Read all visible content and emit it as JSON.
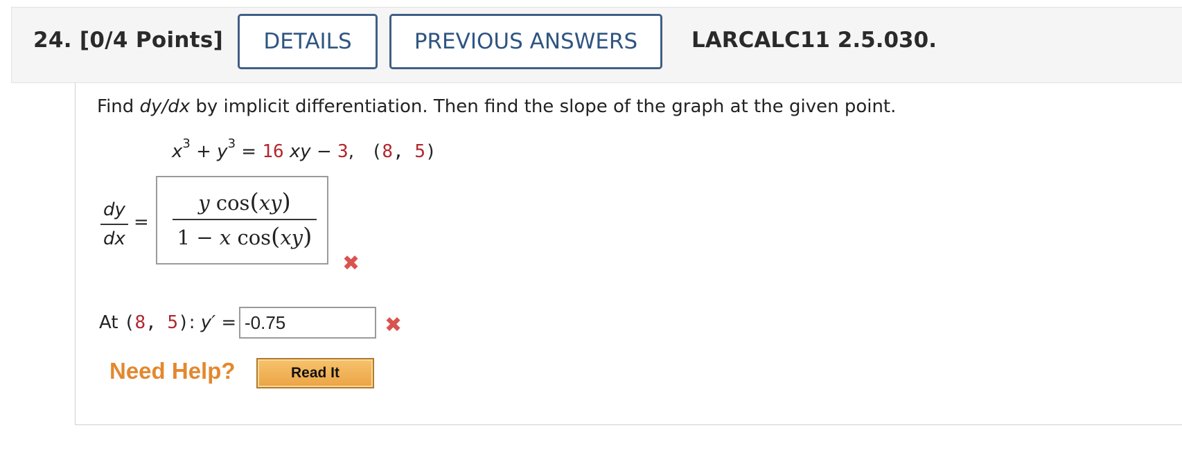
{
  "header": {
    "question_number": "24.",
    "points": "[0/4 Points]",
    "details_label": "DETAILS",
    "previous_answers_label": "PREVIOUS ANSWERS",
    "problem_code": "LARCALC11 2.5.030."
  },
  "question": {
    "prompt_find": "Find ",
    "prompt_dydx": "dy/dx",
    "prompt_rest": " by implicit differentiation. Then find the slope of the graph at the given point.",
    "eq_x": "x",
    "eq_exp1": "3",
    "eq_plus": " + ",
    "eq_y": "y",
    "eq_exp2": "3",
    "eq_equals": " = ",
    "eq_coef": "16",
    "eq_xy": " xy",
    "eq_minus": " − ",
    "eq_const": "3",
    "eq_comma": ",   ",
    "point": "(8, 5)"
  },
  "derivative": {
    "label_num": "dy",
    "label_den": "dx",
    "equals": "=",
    "answer_num_y": "y",
    "answer_num_cos": " cos",
    "answer_num_xy": "xy",
    "answer_den_one": "1",
    "answer_den_minus": " − ",
    "answer_den_x": "x",
    "answer_den_cos": " cos",
    "answer_den_xy": "xy",
    "status": "incorrect"
  },
  "slope": {
    "at_label": "At ",
    "point": "(8, 5)",
    "colon": ": ",
    "y_prime": "y′",
    "equals": " =",
    "value": "-0.75",
    "status": "incorrect"
  },
  "help": {
    "need_help_label": "Need Help?",
    "read_it_label": "Read It"
  },
  "colors": {
    "button_border": "#3f5f86",
    "button_text": "#2f5581",
    "given_values": "#b1272d",
    "incorrect_mark": "#d9534f",
    "need_help": "#e3882f",
    "read_it_bg": "#eba445"
  }
}
